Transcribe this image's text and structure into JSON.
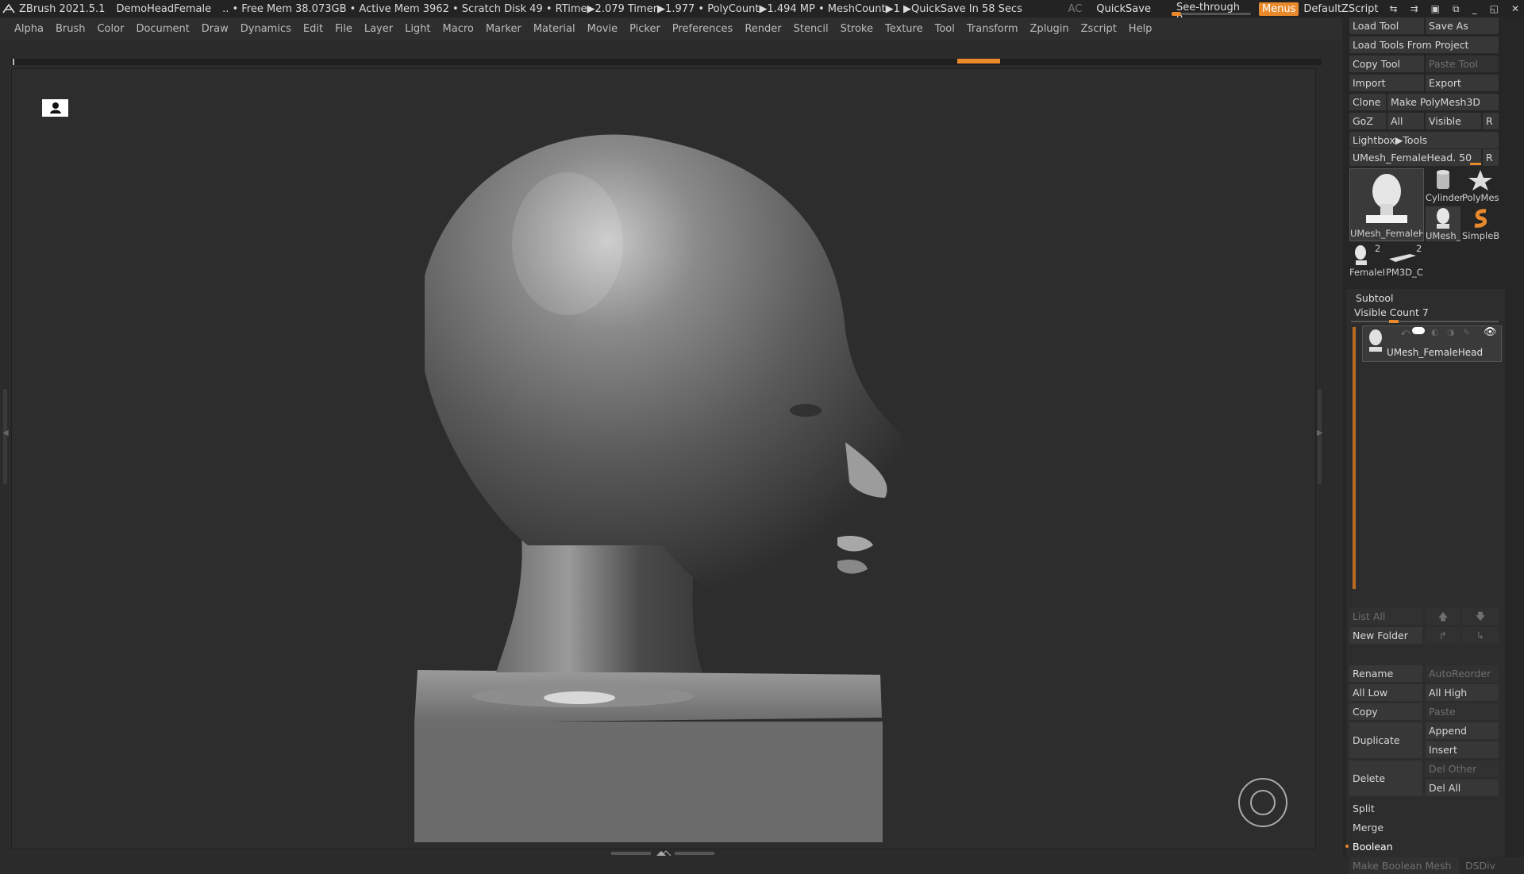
{
  "titlebar": {
    "app": "ZBrush 2021.5.1",
    "document": "DemoHeadFemale",
    "stats": ".. • Free Mem 38.073GB • Active Mem 3962 • Scratch Disk 49 • RTime▶2.079 Timer▶1.977 • PolyCount▶1.494 MP • MeshCount▶1 ▶QuickSave In 58 Secs",
    "ac": "AC",
    "quicksave": "QuickSave",
    "see_through_label": "See-through",
    "see_through_value": "0",
    "menus": "Menus",
    "script": "DefaultZScript",
    "icons": [
      "swap-icon",
      "layout-icon",
      "window-icon",
      "restore-icon",
      "minimize-icon",
      "maximize-icon",
      "close-icon"
    ]
  },
  "menubar": [
    "Alpha",
    "Brush",
    "Color",
    "Document",
    "Draw",
    "Dynamics",
    "Edit",
    "File",
    "Layer",
    "Light",
    "Macro",
    "Marker",
    "Material",
    "Movie",
    "Picker",
    "Preferences",
    "Render",
    "Stencil",
    "Stroke",
    "Texture",
    "Tool",
    "Transform",
    "Zplugin",
    "Zscript",
    "Help"
  ],
  "tool_panel": {
    "load_tool": "Load Tool",
    "save_as": "Save As",
    "load_from_project": "Load Tools From Project",
    "copy_tool": "Copy Tool",
    "paste_tool": "Paste Tool",
    "import": "Import",
    "export": "Export",
    "clone": "Clone",
    "make_polymesh": "Make PolyMesh3D",
    "goz": "GoZ",
    "all": "All",
    "visible": "Visible",
    "r": "R",
    "lightbox_tools": "Lightbox▶Tools",
    "current_tool": "UMesh_FemaleHead. 50",
    "r2": "R",
    "thumbs": {
      "main": "UMesh_FemaleH",
      "cylinder": "Cylinder",
      "polymesh": "PolyMes",
      "umesh_small": "UMesh_",
      "simpleb": "SimpleB",
      "female": "FemaleH",
      "female_count": "2",
      "pm3d": "PM3D_C",
      "pm3d_count": "2"
    }
  },
  "subtool": {
    "title": "Subtool",
    "visible_count": "Visible Count 7",
    "item_name": "UMesh_FemaleHead",
    "list_all": "List All",
    "new_folder": "New Folder",
    "rename": "Rename",
    "autoreorder": "AutoReorder",
    "all_low": "All Low",
    "all_high": "All High",
    "copy": "Copy",
    "paste": "Paste",
    "duplicate": "Duplicate",
    "append": "Append",
    "insert": "Insert",
    "delete": "Delete",
    "del_other": "Del Other",
    "del_all": "Del All",
    "split": "Split",
    "merge": "Merge",
    "boolean": "Boolean",
    "make_boolean_mesh": "Make Boolean Mesh",
    "dsdiv": "DSDiv"
  },
  "colors": {
    "accent": "#e8892c",
    "bg": "#2b2b2b",
    "panel": "#262626",
    "button": "#373737"
  }
}
